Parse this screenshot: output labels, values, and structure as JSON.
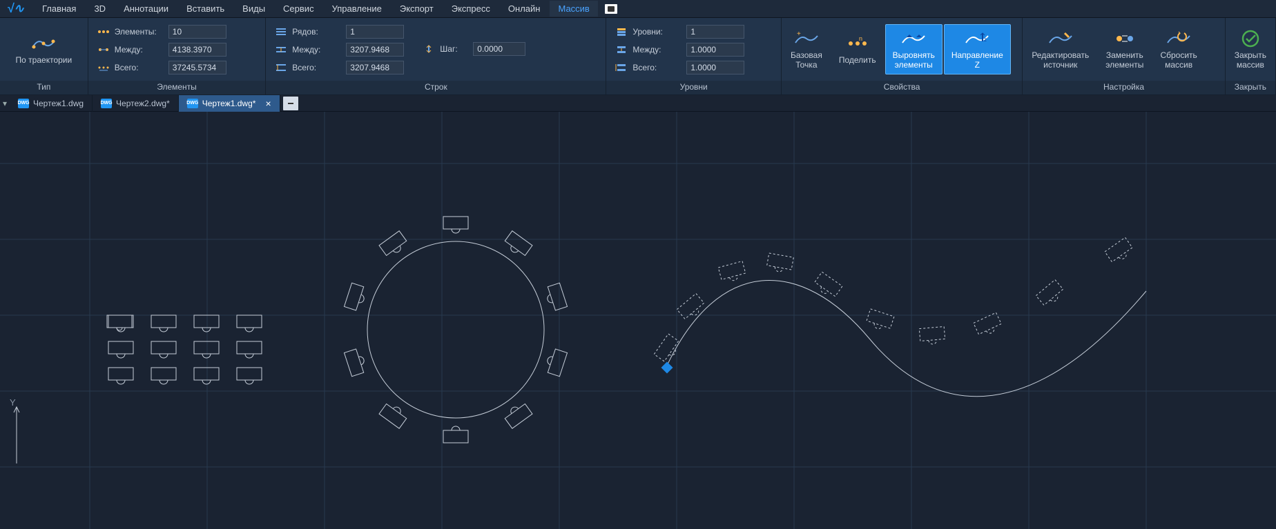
{
  "menu": {
    "items": [
      "Главная",
      "3D",
      "Аннотации",
      "Вставить",
      "Виды",
      "Сервис",
      "Управление",
      "Экспорт",
      "Экспресс",
      "Онлайн",
      "Массив"
    ],
    "active_index": 10
  },
  "ribbon": {
    "type": {
      "label": "Тип",
      "trajectory": "По траектории"
    },
    "elements_panel": {
      "label": "Элементы",
      "rows": [
        {
          "name": "Элементы:",
          "value": "10"
        },
        {
          "name": "Между:",
          "value": "4138.3970"
        },
        {
          "name": "Всего:",
          "value": "37245.5734"
        }
      ]
    },
    "rows_panel": {
      "label": "Строк",
      "left": [
        {
          "name": "Рядов:",
          "value": "1"
        },
        {
          "name": "Между:",
          "value": "3207.9468"
        },
        {
          "name": "Всего:",
          "value": "3207.9468"
        }
      ],
      "step": {
        "name": "Шаг:",
        "value": "0.0000"
      }
    },
    "levels_panel": {
      "label": "Уровни",
      "rows": [
        {
          "name": "Уровни:",
          "value": "1"
        },
        {
          "name": "Между:",
          "value": "1.0000"
        },
        {
          "name": "Всего:",
          "value": "1.0000"
        }
      ]
    },
    "props_panel": {
      "label": "Свойства",
      "buttons": {
        "base_point": "Базовая\nТочка",
        "divide": "Поделить",
        "align": "Выровнять\nэлементы",
        "direction_z": "Направление\nZ"
      }
    },
    "setup_panel": {
      "label": "Настройка",
      "buttons": {
        "edit_source": "Редактировать\nисточник",
        "replace": "Заменить\nэлементы",
        "reset": "Сбросить\nмассив"
      }
    },
    "close_panel": {
      "label": "Закрыть",
      "button": "Закрыть\nмассив"
    }
  },
  "tabs": {
    "items": [
      {
        "name": "Чертеж1.dwg",
        "active": false
      },
      {
        "name": "Чертеж2.dwg*",
        "active": false
      },
      {
        "name": "Чертеж1.dwg*",
        "active": true
      }
    ]
  }
}
